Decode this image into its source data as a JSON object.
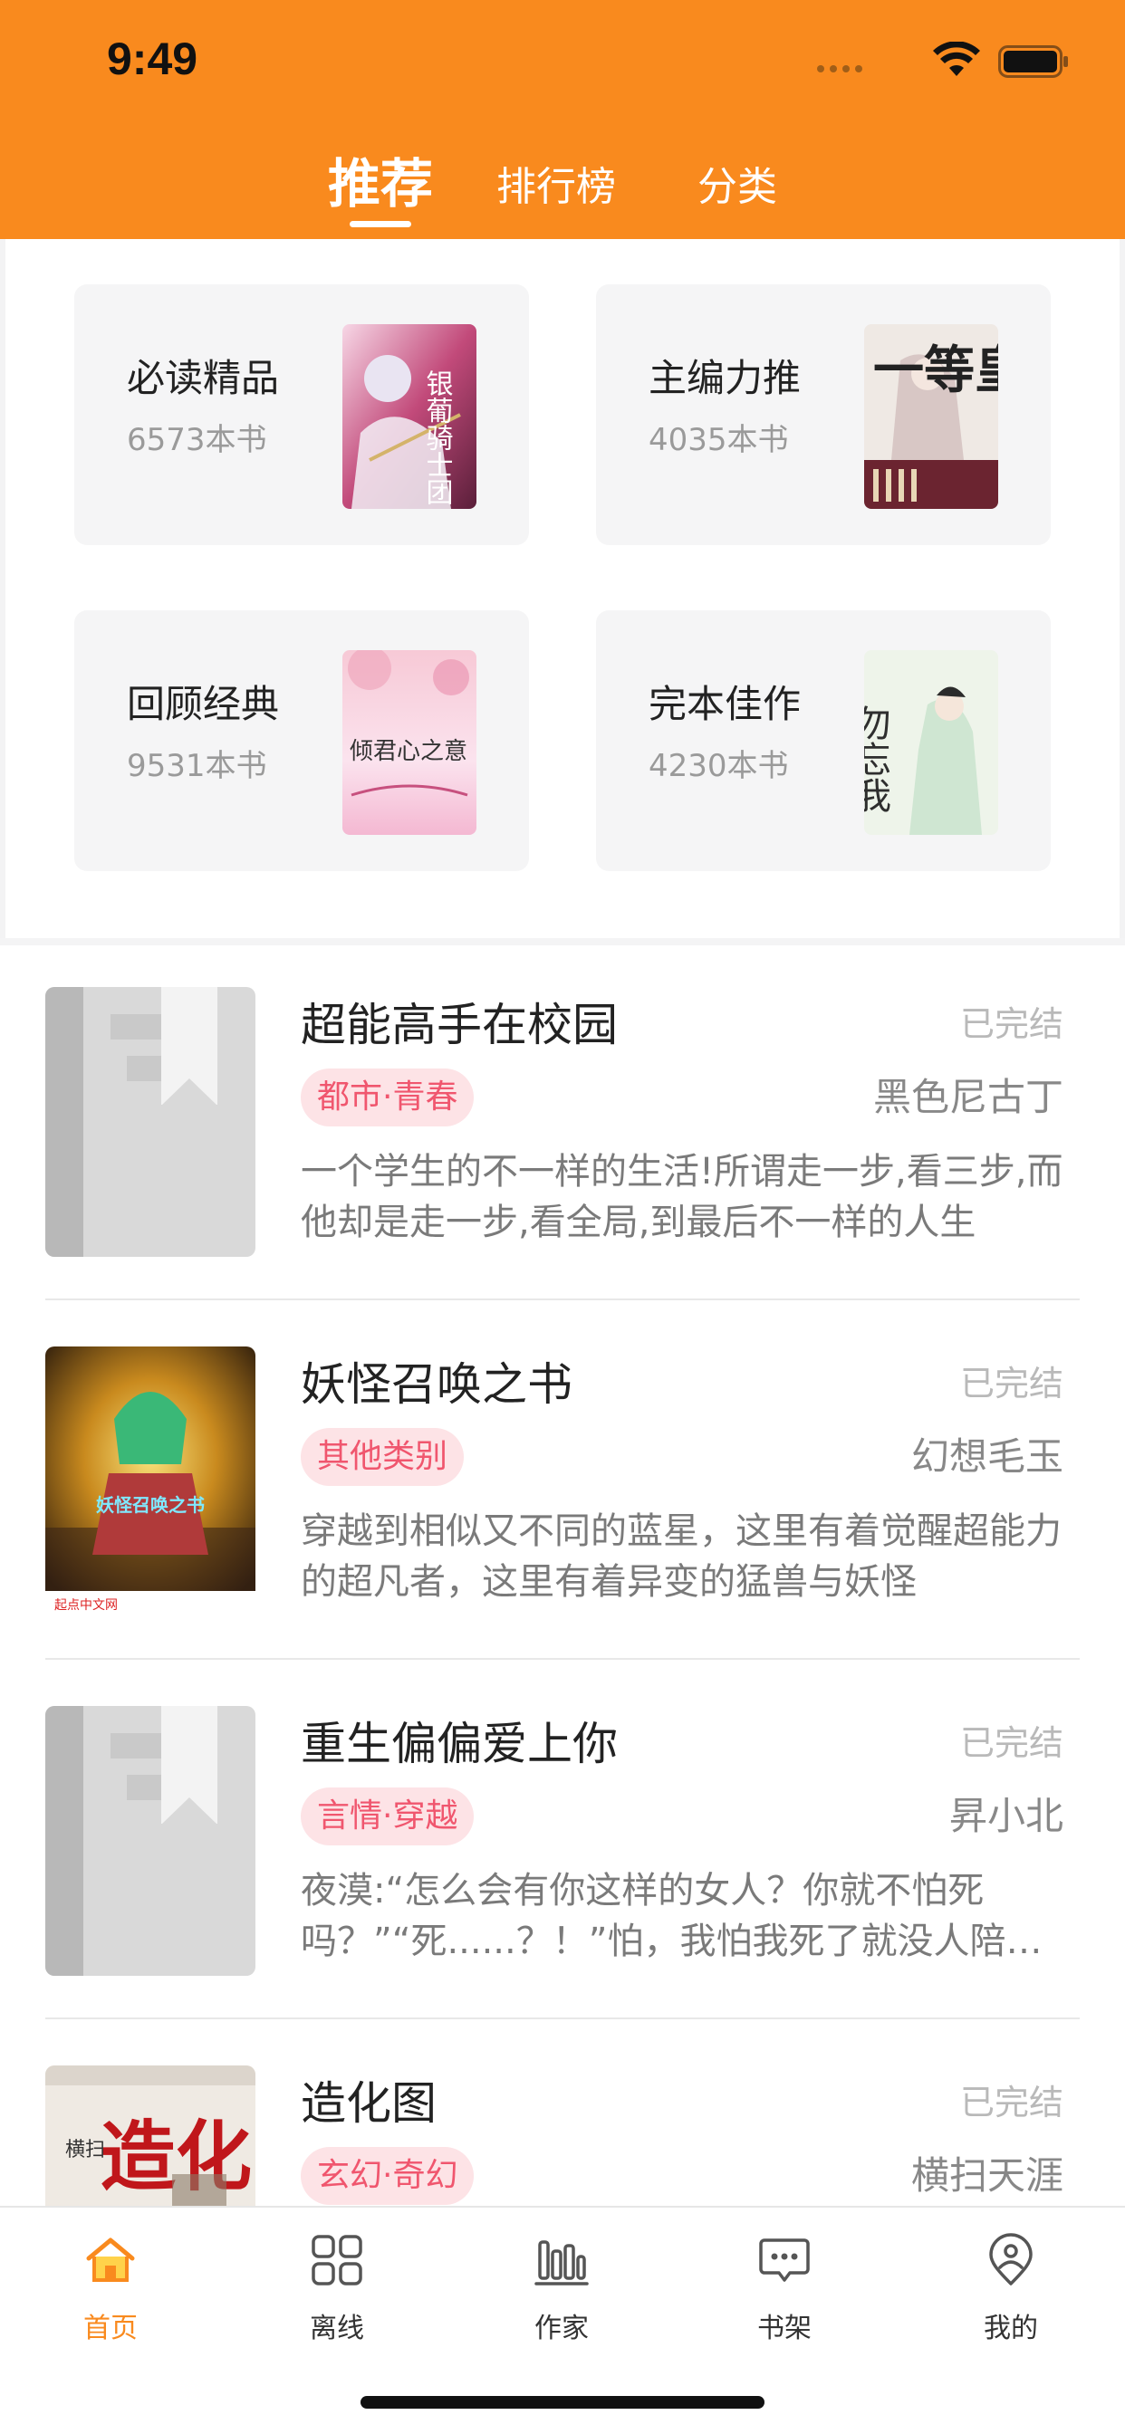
{
  "status_bar": {
    "time": "9:49"
  },
  "top_tabs": [
    {
      "label": "推荐",
      "active": true
    },
    {
      "label": "排行榜",
      "active": false
    },
    {
      "label": "分类",
      "active": false
    }
  ],
  "categories": [
    {
      "title": "必读精品",
      "count": "6573本书",
      "cover_text": "银葡骑士团"
    },
    {
      "title": "主编力推",
      "count": "4035本书",
      "cover_text": "一等皇后"
    },
    {
      "title": "回顾经典",
      "count": "9531本书",
      "cover_text": "倾君心之意"
    },
    {
      "title": "完本佳作",
      "count": "4230本书",
      "cover_text": "勿忘我"
    }
  ],
  "books": [
    {
      "title": "超能高手在校园",
      "status": "已完结",
      "tag": "都市·青春",
      "author": "黑色尼古丁",
      "desc": "一个学生的不一样的生活!所谓走一步,看三步,而他却是走一步,看全局,到最后不一样的人生"
    },
    {
      "title": "妖怪召唤之书",
      "status": "已完结",
      "tag": "其他类别",
      "author": "幻想毛玉",
      "desc": "穿越到相似又不同的蓝星，这里有着觉醒超能力的超凡者，这里有着异变的猛兽与妖怪",
      "cover_text": "妖怪召唤之书",
      "cover_footer": "起点中文网"
    },
    {
      "title": "重生偏偏爱上你",
      "status": "已完结",
      "tag": "言情·穿越",
      "author": "昇小北",
      "desc": "夜漠:“怎么会有你这样的女人？你就不怕死吗？”“死......？！”怕，我怕我死了就没人陪你了"
    },
    {
      "title": "造化图",
      "status": "已完结",
      "tag": "玄幻·奇幻",
      "author": "横扫天涯",
      "cover_text": "造化",
      "cover_side": "横扫"
    }
  ],
  "bottom_tabs": [
    {
      "label": "首页",
      "icon": "home-icon",
      "active": true
    },
    {
      "label": "离线",
      "icon": "grid-icon",
      "active": false
    },
    {
      "label": "作家",
      "icon": "bars-icon",
      "active": false
    },
    {
      "label": "书架",
      "icon": "chat-icon",
      "active": false
    },
    {
      "label": "我的",
      "icon": "location-user-icon",
      "active": false
    }
  ],
  "colors": {
    "brand": "#F98A1E",
    "tag_bg": "#fde3e6",
    "tag_text": "#f0566e"
  }
}
